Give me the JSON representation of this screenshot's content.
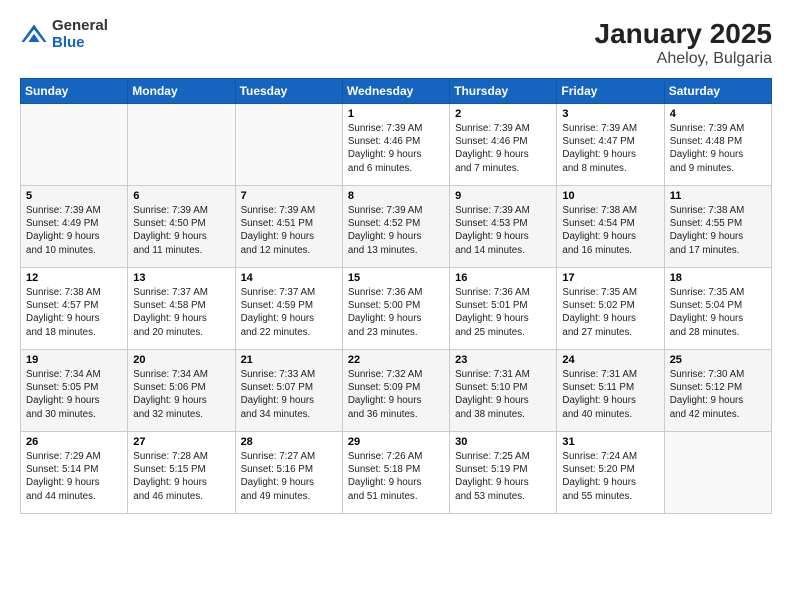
{
  "header": {
    "logo_general": "General",
    "logo_blue": "Blue",
    "title": "January 2025",
    "subtitle": "Aheloy, Bulgaria"
  },
  "days_of_week": [
    "Sunday",
    "Monday",
    "Tuesday",
    "Wednesday",
    "Thursday",
    "Friday",
    "Saturday"
  ],
  "weeks": [
    [
      {
        "day": "",
        "detail": ""
      },
      {
        "day": "",
        "detail": ""
      },
      {
        "day": "",
        "detail": ""
      },
      {
        "day": "1",
        "detail": "Sunrise: 7:39 AM\nSunset: 4:46 PM\nDaylight: 9 hours\nand 6 minutes."
      },
      {
        "day": "2",
        "detail": "Sunrise: 7:39 AM\nSunset: 4:46 PM\nDaylight: 9 hours\nand 7 minutes."
      },
      {
        "day": "3",
        "detail": "Sunrise: 7:39 AM\nSunset: 4:47 PM\nDaylight: 9 hours\nand 8 minutes."
      },
      {
        "day": "4",
        "detail": "Sunrise: 7:39 AM\nSunset: 4:48 PM\nDaylight: 9 hours\nand 9 minutes."
      }
    ],
    [
      {
        "day": "5",
        "detail": "Sunrise: 7:39 AM\nSunset: 4:49 PM\nDaylight: 9 hours\nand 10 minutes."
      },
      {
        "day": "6",
        "detail": "Sunrise: 7:39 AM\nSunset: 4:50 PM\nDaylight: 9 hours\nand 11 minutes."
      },
      {
        "day": "7",
        "detail": "Sunrise: 7:39 AM\nSunset: 4:51 PM\nDaylight: 9 hours\nand 12 minutes."
      },
      {
        "day": "8",
        "detail": "Sunrise: 7:39 AM\nSunset: 4:52 PM\nDaylight: 9 hours\nand 13 minutes."
      },
      {
        "day": "9",
        "detail": "Sunrise: 7:39 AM\nSunset: 4:53 PM\nDaylight: 9 hours\nand 14 minutes."
      },
      {
        "day": "10",
        "detail": "Sunrise: 7:38 AM\nSunset: 4:54 PM\nDaylight: 9 hours\nand 16 minutes."
      },
      {
        "day": "11",
        "detail": "Sunrise: 7:38 AM\nSunset: 4:55 PM\nDaylight: 9 hours\nand 17 minutes."
      }
    ],
    [
      {
        "day": "12",
        "detail": "Sunrise: 7:38 AM\nSunset: 4:57 PM\nDaylight: 9 hours\nand 18 minutes."
      },
      {
        "day": "13",
        "detail": "Sunrise: 7:37 AM\nSunset: 4:58 PM\nDaylight: 9 hours\nand 20 minutes."
      },
      {
        "day": "14",
        "detail": "Sunrise: 7:37 AM\nSunset: 4:59 PM\nDaylight: 9 hours\nand 22 minutes."
      },
      {
        "day": "15",
        "detail": "Sunrise: 7:36 AM\nSunset: 5:00 PM\nDaylight: 9 hours\nand 23 minutes."
      },
      {
        "day": "16",
        "detail": "Sunrise: 7:36 AM\nSunset: 5:01 PM\nDaylight: 9 hours\nand 25 minutes."
      },
      {
        "day": "17",
        "detail": "Sunrise: 7:35 AM\nSunset: 5:02 PM\nDaylight: 9 hours\nand 27 minutes."
      },
      {
        "day": "18",
        "detail": "Sunrise: 7:35 AM\nSunset: 5:04 PM\nDaylight: 9 hours\nand 28 minutes."
      }
    ],
    [
      {
        "day": "19",
        "detail": "Sunrise: 7:34 AM\nSunset: 5:05 PM\nDaylight: 9 hours\nand 30 minutes."
      },
      {
        "day": "20",
        "detail": "Sunrise: 7:34 AM\nSunset: 5:06 PM\nDaylight: 9 hours\nand 32 minutes."
      },
      {
        "day": "21",
        "detail": "Sunrise: 7:33 AM\nSunset: 5:07 PM\nDaylight: 9 hours\nand 34 minutes."
      },
      {
        "day": "22",
        "detail": "Sunrise: 7:32 AM\nSunset: 5:09 PM\nDaylight: 9 hours\nand 36 minutes."
      },
      {
        "day": "23",
        "detail": "Sunrise: 7:31 AM\nSunset: 5:10 PM\nDaylight: 9 hours\nand 38 minutes."
      },
      {
        "day": "24",
        "detail": "Sunrise: 7:31 AM\nSunset: 5:11 PM\nDaylight: 9 hours\nand 40 minutes."
      },
      {
        "day": "25",
        "detail": "Sunrise: 7:30 AM\nSunset: 5:12 PM\nDaylight: 9 hours\nand 42 minutes."
      }
    ],
    [
      {
        "day": "26",
        "detail": "Sunrise: 7:29 AM\nSunset: 5:14 PM\nDaylight: 9 hours\nand 44 minutes."
      },
      {
        "day": "27",
        "detail": "Sunrise: 7:28 AM\nSunset: 5:15 PM\nDaylight: 9 hours\nand 46 minutes."
      },
      {
        "day": "28",
        "detail": "Sunrise: 7:27 AM\nSunset: 5:16 PM\nDaylight: 9 hours\nand 49 minutes."
      },
      {
        "day": "29",
        "detail": "Sunrise: 7:26 AM\nSunset: 5:18 PM\nDaylight: 9 hours\nand 51 minutes."
      },
      {
        "day": "30",
        "detail": "Sunrise: 7:25 AM\nSunset: 5:19 PM\nDaylight: 9 hours\nand 53 minutes."
      },
      {
        "day": "31",
        "detail": "Sunrise: 7:24 AM\nSunset: 5:20 PM\nDaylight: 9 hours\nand 55 minutes."
      },
      {
        "day": "",
        "detail": ""
      }
    ]
  ]
}
